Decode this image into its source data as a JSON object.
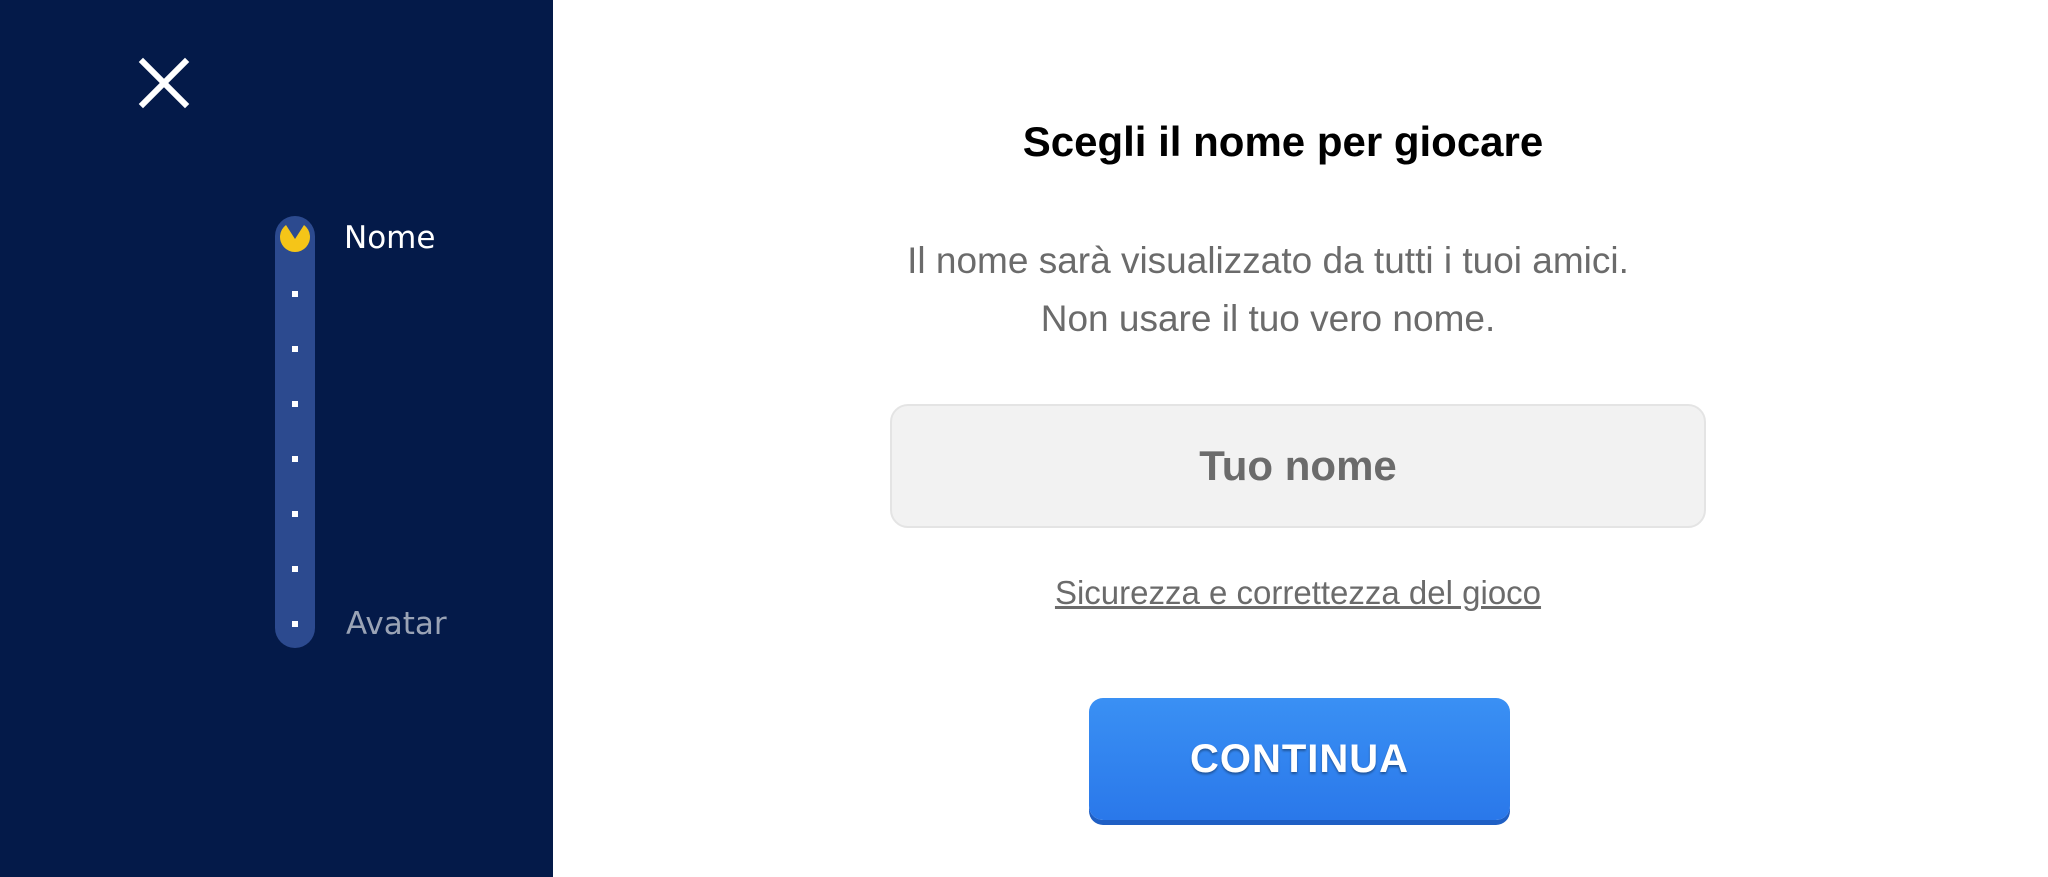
{
  "sidebar": {
    "close_icon": "close-icon",
    "steps": {
      "current_label": "Nome",
      "last_label": "Avatar",
      "current_icon": "pacman-icon"
    }
  },
  "main": {
    "title": "Scegli il nome per giocare",
    "subtitle_line1": "Il nome sarà visualizzato da tutti i tuoi amici.",
    "subtitle_line2": "Non usare il tuo vero nome.",
    "name_input": {
      "placeholder": "Tuo nome",
      "value": ""
    },
    "safety_link": "Sicurezza e correttezza del gioco",
    "continue_label": "CONTINUA"
  },
  "colors": {
    "sidebar_bg": "#041a49",
    "track": "#2c4a8f",
    "active_marker": "#f5c518",
    "button": "#2f80ed"
  }
}
